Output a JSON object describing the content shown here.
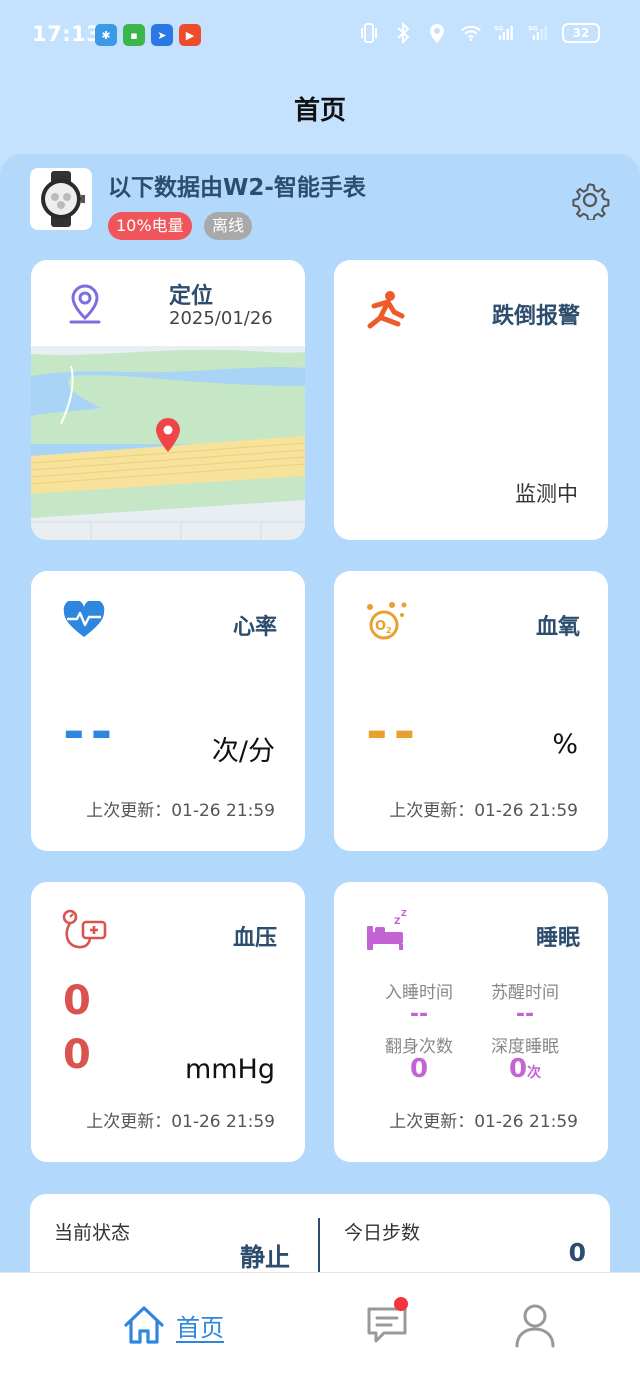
{
  "status_bar": {
    "time": "17:13",
    "battery": "32"
  },
  "page": {
    "title": "首页"
  },
  "device": {
    "name": "以下数据由W2-智能手表",
    "battery_badge": "10%电量",
    "state_badge": "离线"
  },
  "location": {
    "title": "定位",
    "date": "2025/01/26"
  },
  "fall_alarm": {
    "title": "跌倒报警",
    "status": "监测中"
  },
  "heart_rate": {
    "title": "心率",
    "value": "--",
    "unit": "次/分",
    "updated": "上次更新：01-26 21:59"
  },
  "blood_oxygen": {
    "title": "血氧",
    "value": "--",
    "unit": "%",
    "updated": "上次更新：01-26 21:59"
  },
  "blood_pressure": {
    "title": "血压",
    "systolic": "0",
    "diastolic": "0",
    "unit": "mmHg",
    "updated": "上次更新：01-26 21:59"
  },
  "sleep": {
    "title": "睡眠",
    "fall_asleep_label": "入睡时间",
    "fall_asleep_value": "--",
    "wake_label": "苏醒时间",
    "wake_value": "--",
    "turns_label": "翻身次数",
    "turns_value": "0",
    "deep_label": "深度睡眠",
    "deep_value": "0",
    "deep_unit": "次",
    "updated": "上次更新：01-26 21:59"
  },
  "activity": {
    "state_label": "当前状态",
    "state_value": "静止",
    "steps_label": "今日步数",
    "steps_value": "0"
  },
  "tabs": {
    "home_label": "首页"
  },
  "colors": {
    "background": "#c4e1fd",
    "panel": "#b2d8fb",
    "title": "#2d4d6e",
    "heart": "#2e86de",
    "oxygen": "#e8a030",
    "pressure": "#d9534f",
    "sleep": "#c264d4",
    "alert": "#f0555b"
  },
  "icons": [
    "location-pin-icon",
    "fall-person-icon",
    "heart-pulse-icon",
    "oxygen-icon",
    "blood-pressure-icon",
    "sleep-bed-icon",
    "gear-icon",
    "home-icon",
    "message-icon",
    "user-icon"
  ]
}
